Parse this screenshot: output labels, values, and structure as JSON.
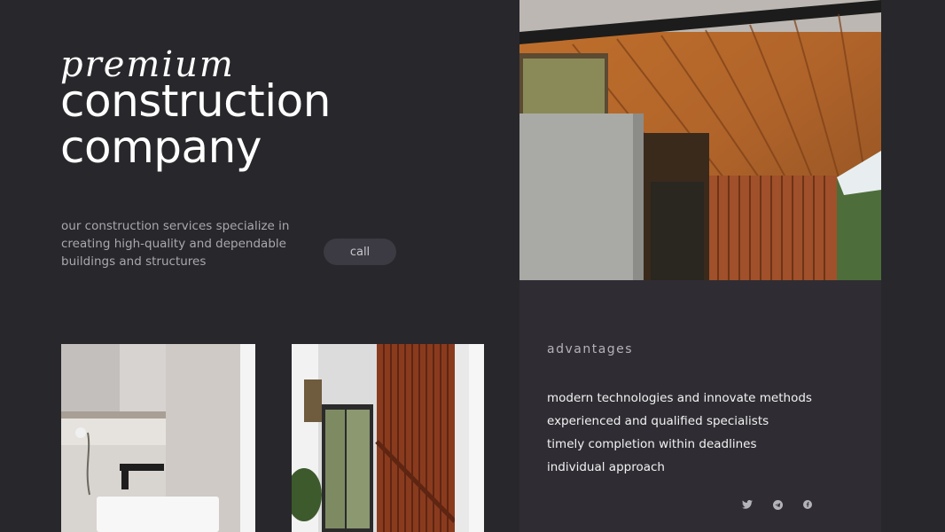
{
  "hero": {
    "title_script": "premium",
    "title_line1": "construction",
    "title_line2": "company",
    "description": "our construction services specialize in creating high-quality and dependable buildings and structures",
    "call_label": "call"
  },
  "advantages": {
    "heading": "advantages",
    "items": [
      "modern technologies and innovate methods",
      "experienced and qualified specialists",
      "timely completion within deadlines",
      "individual approach"
    ]
  },
  "social": {
    "icons": [
      "twitter-icon",
      "telegram-icon",
      "facebook-icon"
    ]
  },
  "colors": {
    "background": "#28272b",
    "panel": "#2f2d33",
    "button": "#3c3a42",
    "muted_text": "#a9a8ae"
  }
}
